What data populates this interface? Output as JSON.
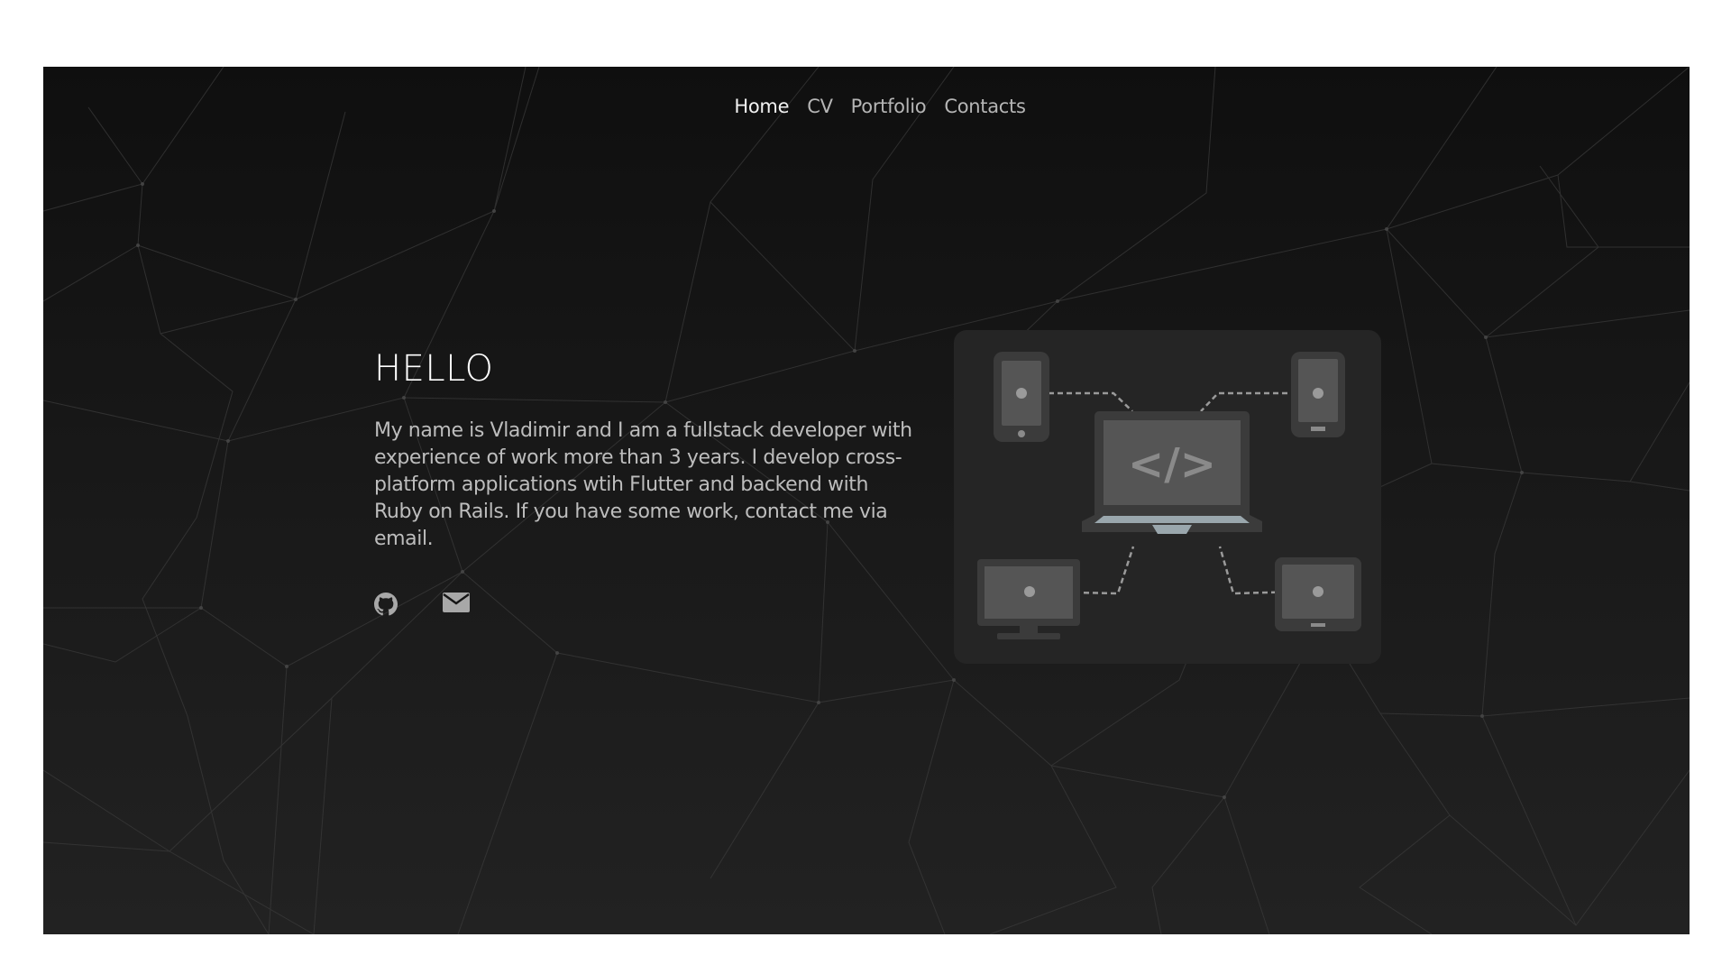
{
  "nav": {
    "items": [
      {
        "label": "Home",
        "active": true
      },
      {
        "label": "CV",
        "active": false
      },
      {
        "label": "Portfolio",
        "active": false
      },
      {
        "label": "Contacts",
        "active": false
      }
    ]
  },
  "hero": {
    "title": "HELLO",
    "bio": "My name is Vladimir and I am a fullstack developer with experience of work more than 3 years. I develop cross-platform applications wtih Flutter and backend with Ruby on Rails. If you have some work, contact me via email."
  },
  "social": {
    "icons": [
      "github-icon",
      "mail-icon"
    ]
  },
  "illustration": {
    "code_glyph": "</>"
  },
  "colors": {
    "background_top": "#0f0f0f",
    "background_bottom": "#222222",
    "text_primary": "#ffffff",
    "text_secondary": "#bdbdbd",
    "icon": "#a8a8a8"
  }
}
